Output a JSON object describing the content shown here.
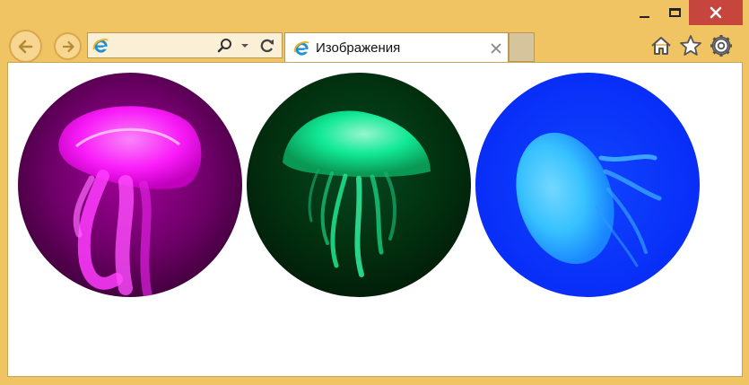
{
  "window": {
    "controls": [
      "minimize-icon",
      "maximize-icon",
      "close-icon"
    ]
  },
  "toolbar": {
    "address_value": "",
    "nav_icons": [
      "back-arrow-icon",
      "forward-arrow-icon"
    ],
    "address_icons": [
      "ie-logo-icon",
      "search-icon",
      "dropdown-arrow-icon",
      "refresh-icon"
    ],
    "tool_icons": [
      "home-icon",
      "favorites-star-icon",
      "gear-icon"
    ]
  },
  "tab": {
    "title": "Изображения",
    "icon": "ie-logo-icon",
    "close_icon": "close-icon"
  },
  "page": {
    "images": [
      {
        "name": "magenta-jellyfish",
        "color": "#ff1cff",
        "background": "#5a0052"
      },
      {
        "name": "green-jellyfish",
        "color": "#12f29c",
        "background": "#022c12"
      },
      {
        "name": "blue-jellyfish",
        "color": "#3bd0ff",
        "background": "#0a2cff"
      }
    ]
  },
  "colors": {
    "frame": "#f0c462",
    "close_button": "#c6463d",
    "content_bg": "#ffffff"
  }
}
